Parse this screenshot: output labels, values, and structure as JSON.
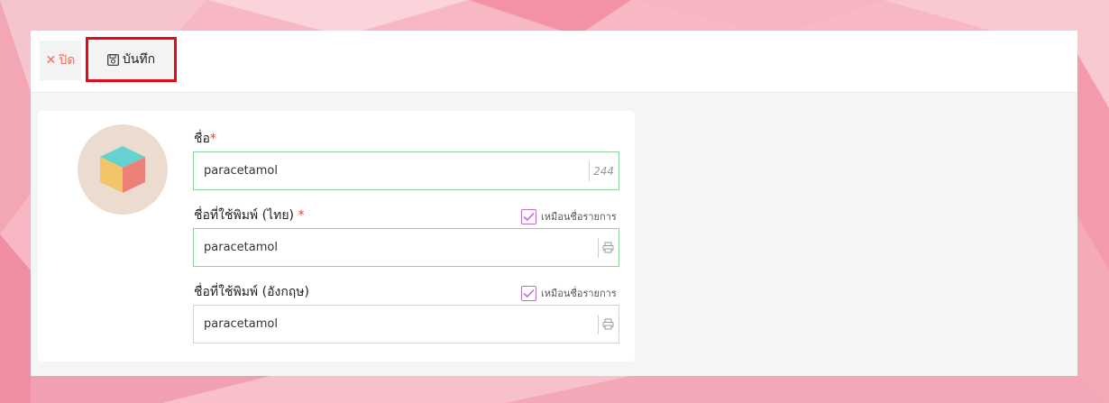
{
  "toolbar": {
    "close_label": "ปิด",
    "save_label": "บันทึก"
  },
  "form": {
    "name": {
      "label": "ชื่อ",
      "required_mark": "*",
      "value": "paracetamol",
      "char_count": "244"
    },
    "print_name_th": {
      "label": "ชื่อที่ใช้พิมพ์ (ไทย)",
      "required_mark": "*",
      "value": "paracetamol",
      "same_as_label": "เหมือนชื่อรายการ",
      "same_as_checked": true
    },
    "print_name_en": {
      "label": "ชื่อที่ใช้พิมพ์ (อังกฤษ)",
      "value": "paracetamol",
      "same_as_label": "เหมือนชื่อรายการ",
      "same_as_checked": true
    }
  },
  "colors": {
    "accent_close": "#f0715b",
    "highlight_box": "#e30b17",
    "active_field_border": "#8fd49a",
    "checkbox": "#c06bd0"
  },
  "icons": {
    "close": "close-icon",
    "save": "save-icon",
    "print": "printer-icon",
    "product": "cube-icon",
    "checkbox": "checkmark-icon"
  }
}
